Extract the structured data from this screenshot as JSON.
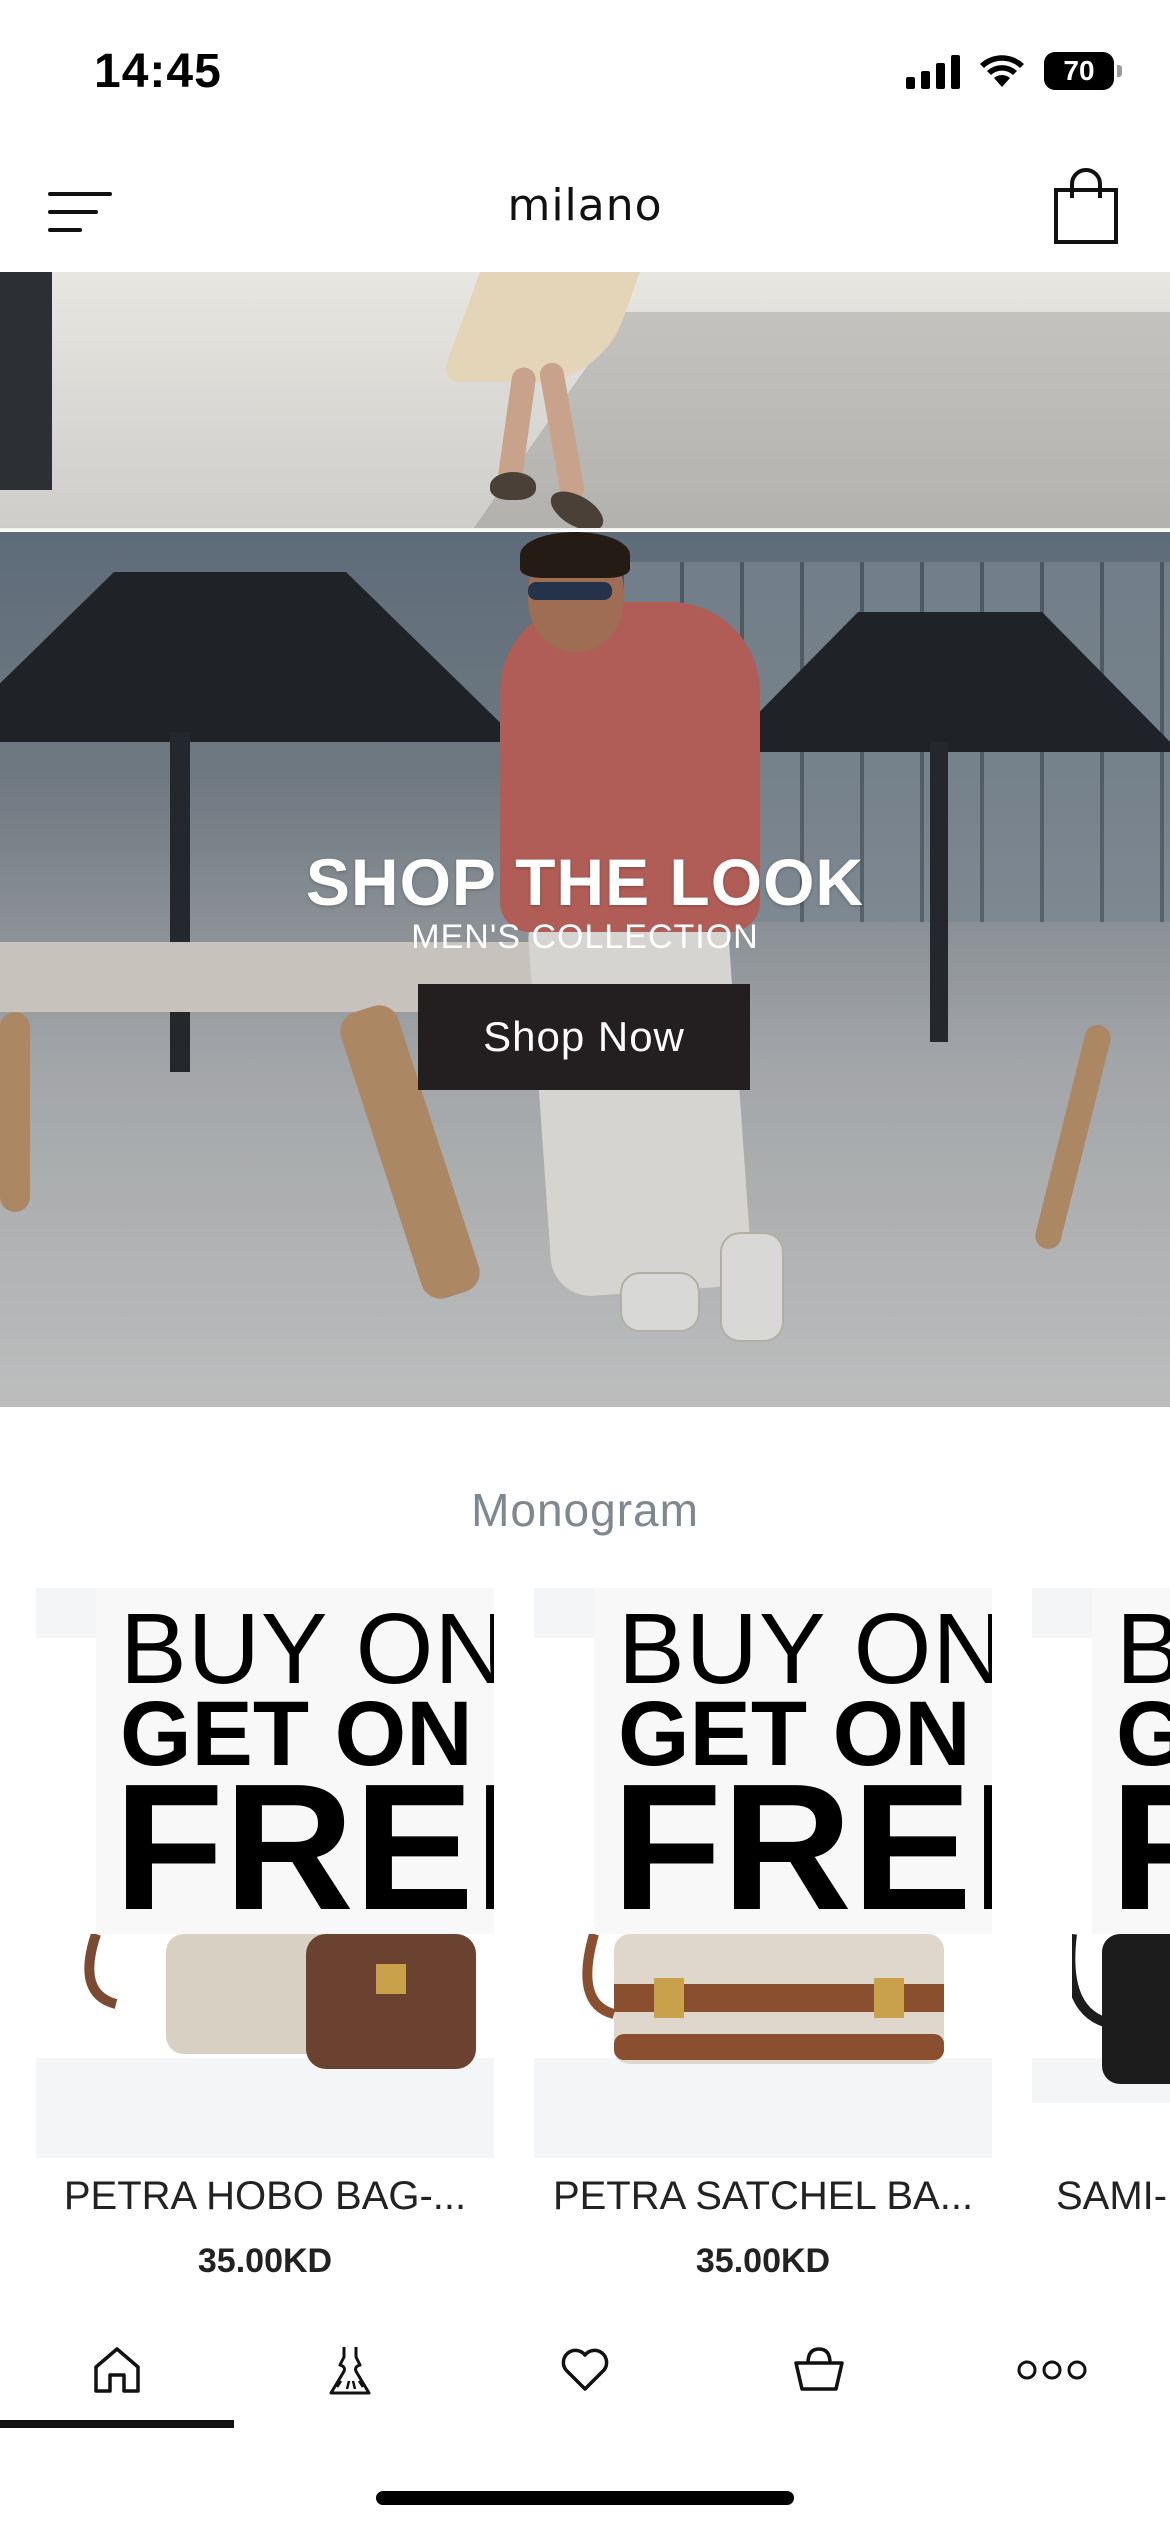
{
  "status_bar": {
    "time": "14:45",
    "battery": "70"
  },
  "header": {
    "brand": "milano"
  },
  "hero": {
    "title": "SHOP THE LOOK",
    "subtitle": "MEN'S COLLECTION",
    "button_label": "Shop Now"
  },
  "section": {
    "title": "Monogram"
  },
  "products": [
    {
      "promo_line1": "BUY ON",
      "promo_line2": "GET ON",
      "promo_line3": "FREE",
      "name": "PETRA HOBO BAG-...",
      "price": "35.00KD"
    },
    {
      "promo_line1": "BUY ON",
      "promo_line2": "GET ON",
      "promo_line3": "FREE",
      "name": "PETRA SATCHEL BA...",
      "price": "35.00KD"
    },
    {
      "promo_line1": "BUY ON",
      "promo_line2": "GET ON",
      "promo_line3": "FREE",
      "name": "SAMI-",
      "price": ""
    }
  ],
  "tabbar": {
    "icons": [
      "home-icon",
      "dress-icon",
      "heart-icon",
      "basket-icon",
      "more-icon"
    ],
    "active_index": 0
  },
  "colors": {
    "button_dark": "#231f20",
    "section_title": "#7f8790",
    "text": "#222222"
  }
}
